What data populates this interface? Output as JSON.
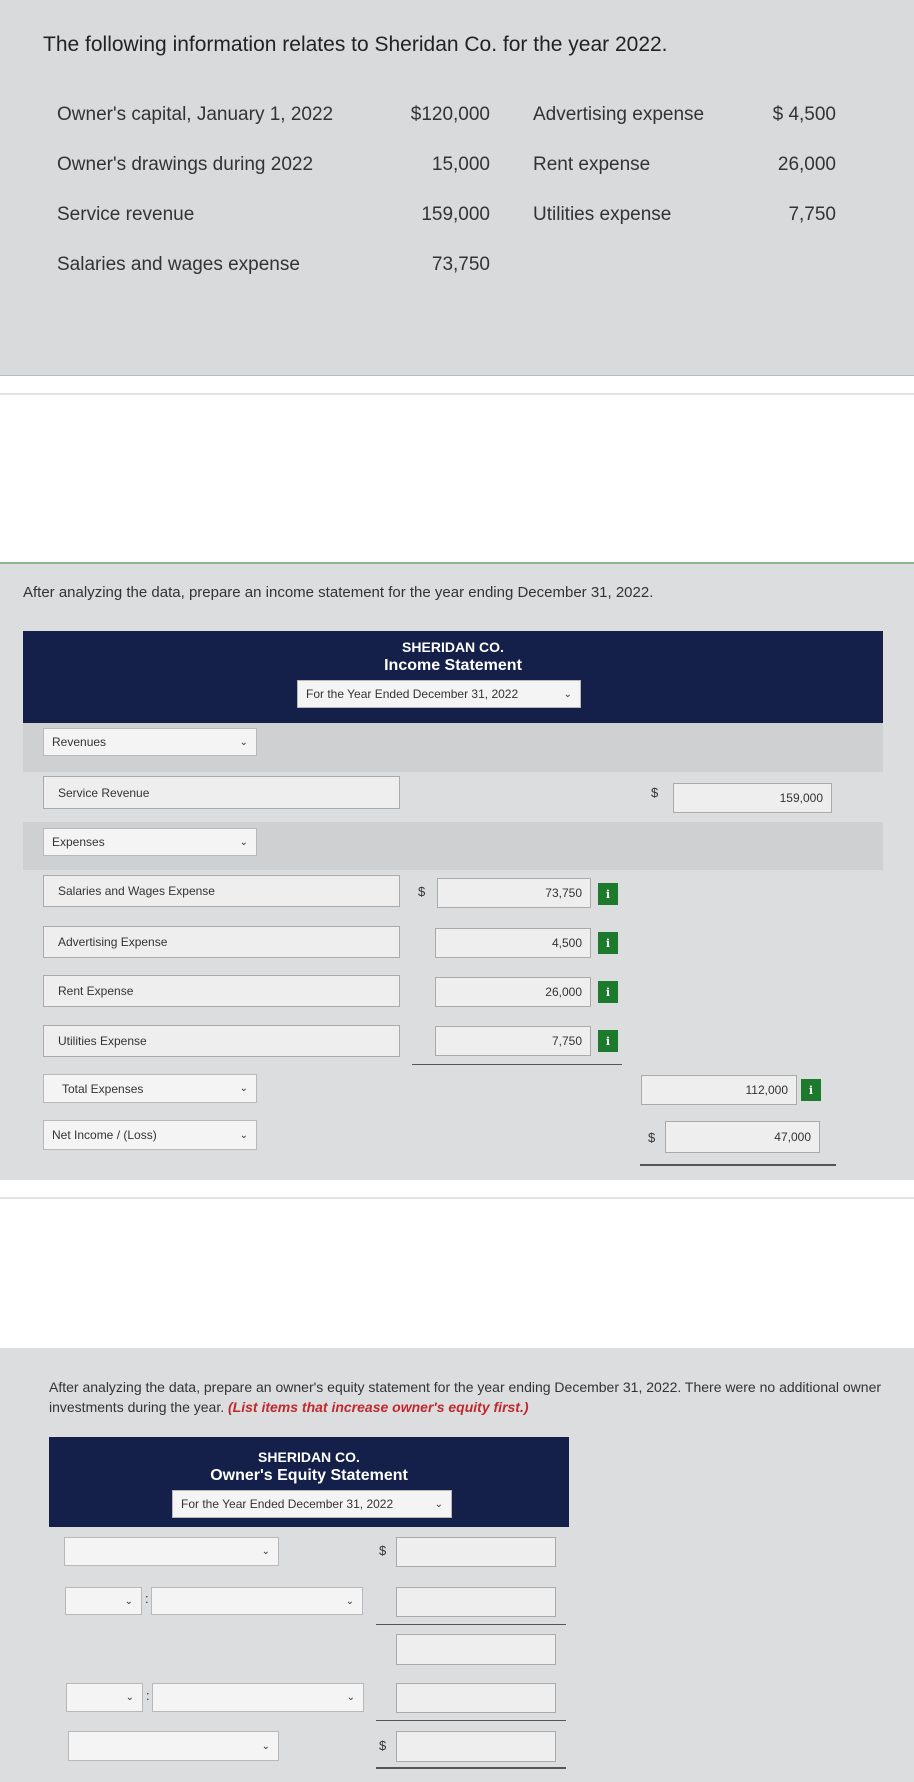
{
  "given": {
    "title": "The following information relates to Sheridan Co. for the year 2022.",
    "items": [
      {
        "label": "Owner's capital, January 1, 2022",
        "value": "$120,000"
      },
      {
        "label": "Owner's drawings during 2022",
        "value": "15,000"
      },
      {
        "label": "Service revenue",
        "value": "159,000"
      },
      {
        "label": "Salaries and wages expense",
        "value": "73,750"
      },
      {
        "label": "Advertising expense",
        "value": "$ 4,500"
      },
      {
        "label": "Rent expense",
        "value": "26,000"
      },
      {
        "label": "Utilities expense",
        "value": "7,750"
      }
    ]
  },
  "income": {
    "instruction": "After analyzing the data, prepare an income statement for the year ending December 31, 2022.",
    "company": "SHERIDAN CO.",
    "statement": "Income Statement",
    "period": "For the Year Ended December 31, 2022",
    "revenues_label": "Revenues",
    "service_revenue_label": "Service Revenue",
    "service_revenue_value": "159,000",
    "expenses_label": "Expenses",
    "expenses": [
      {
        "label": "Salaries and Wages Expense",
        "value": "73,750"
      },
      {
        "label": "Advertising Expense",
        "value": "4,500"
      },
      {
        "label": "Rent Expense",
        "value": "26,000"
      },
      {
        "label": "Utilities Expense",
        "value": "7,750"
      }
    ],
    "total_label": "Total Expenses",
    "total_value": "112,000",
    "net_label": "Net Income / (Loss)",
    "net_value": "47,000",
    "dollar": "$",
    "info": "i"
  },
  "equity": {
    "instruction": "After analyzing the data, prepare an owner's equity statement for the year ending December 31, 2022. There were no additional owner investments during the year.",
    "note": "(List items that increase owner's equity first.)",
    "company": "SHERIDAN CO.",
    "statement": "Owner's Equity Statement",
    "period": "For the Year Ended December 31, 2022",
    "dollar": "$",
    "colon": ":"
  },
  "colors": {
    "header": "#14204a",
    "info_badge": "#1d7a2c",
    "note": "#c0282d"
  }
}
